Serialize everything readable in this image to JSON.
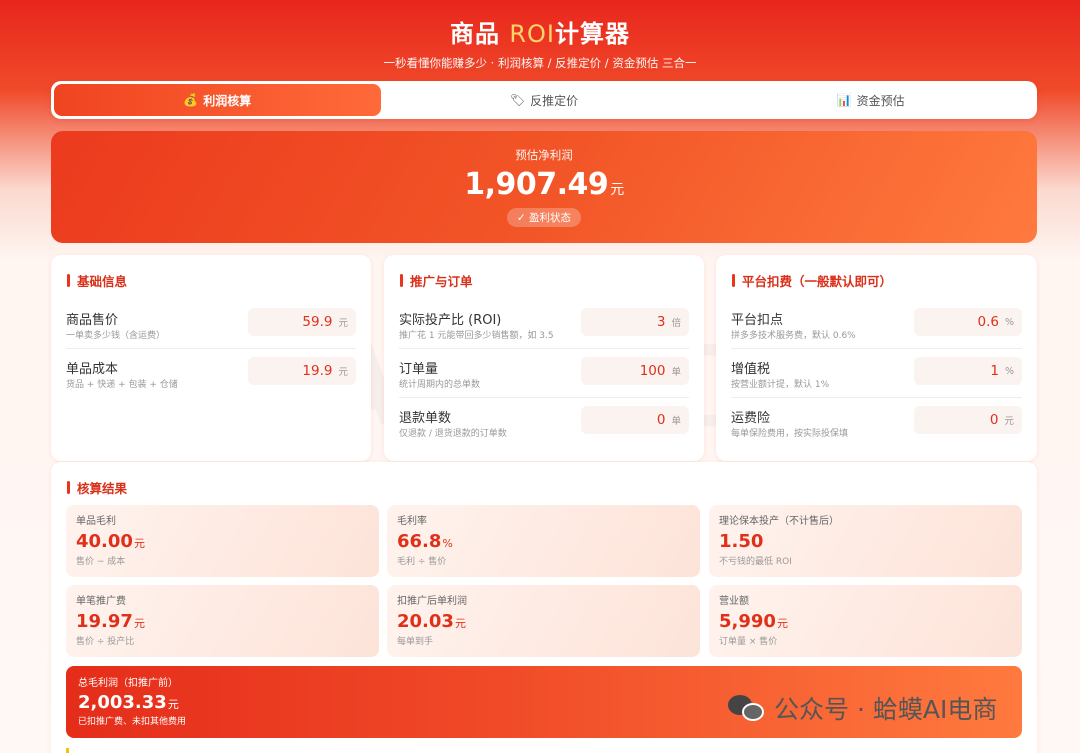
{
  "header": {
    "title_prefix": "商品 ",
    "title_roi": "ROI",
    "title_suffix": "计算器",
    "subtitle": "一秒看懂你能赚多少 · 利润核算 / 反推定价 / 资金预估 三合一"
  },
  "tabs": [
    {
      "icon": "💰",
      "label": "利润核算",
      "active": true
    },
    {
      "icon": "🏷",
      "label": "反推定价",
      "active": false
    },
    {
      "icon": "📊",
      "label": "资金预估",
      "active": false
    }
  ],
  "hero": {
    "label": "预估净利润",
    "value": "1,907.49",
    "unit": "元",
    "badge": "✓ 盈利状态"
  },
  "basic": {
    "title": "基础信息",
    "fields": [
      {
        "name": "商品售价",
        "hint": "一单卖多少钱（含运费）",
        "value": "59.9",
        "unit": "元"
      },
      {
        "name": "单品成本",
        "hint": "货品 + 快递 + 包装 + 仓储",
        "value": "19.9",
        "unit": "元"
      }
    ]
  },
  "promo": {
    "title": "推广与订单",
    "fields": [
      {
        "name": "实际投产比 (ROI)",
        "hint": "推广花 1 元能带回多少销售额，如 3.5",
        "value": "3",
        "unit": "倍"
      },
      {
        "name": "订单量",
        "hint": "统计周期内的总单数",
        "value": "100",
        "unit": "单"
      },
      {
        "name": "退款单数",
        "hint": "仅退款 / 退货退款的订单数",
        "value": "0",
        "unit": "单"
      }
    ]
  },
  "platform": {
    "title": "平台扣费（一般默认即可）",
    "fields": [
      {
        "name": "平台扣点",
        "hint": "拼多多技术服务费，默认 0.6%",
        "value": "0.6",
        "unit": "%"
      },
      {
        "name": "增值税",
        "hint": "按营业额计提，默认 1%",
        "value": "1",
        "unit": "%"
      },
      {
        "name": "运费险",
        "hint": "每单保险费用，按实际投保填",
        "value": "0",
        "unit": "元"
      }
    ]
  },
  "results": {
    "title": "核算结果",
    "items": [
      {
        "label": "单品毛利",
        "value": "40.00",
        "unit": "元",
        "sub": "售价 − 成本"
      },
      {
        "label": "毛利率",
        "value": "66.8",
        "unit": "%",
        "sub": "毛利 ÷ 售价"
      },
      {
        "label": "理论保本投产（不计售后）",
        "value": "1.50",
        "unit": "",
        "sub": "不亏钱的最低 ROI"
      },
      {
        "label": "单笔推广费",
        "value": "19.97",
        "unit": "元",
        "sub": "售价 ÷ 投产比"
      },
      {
        "label": "扣推广后单利润",
        "value": "20.03",
        "unit": "元",
        "sub": "每单到手"
      },
      {
        "label": "营业额",
        "value": "5,990",
        "unit": "元",
        "sub": "订单量 × 售价"
      }
    ],
    "total": {
      "label": "总毛利润（扣推广前）",
      "value": "2,003.33",
      "unit": "元",
      "sub": "已扣推广费、未扣其他费用"
    }
  },
  "watermark": "蛤蟆AI电商工具",
  "wechat_label": "公众号 · 蛤蟆AI电商"
}
